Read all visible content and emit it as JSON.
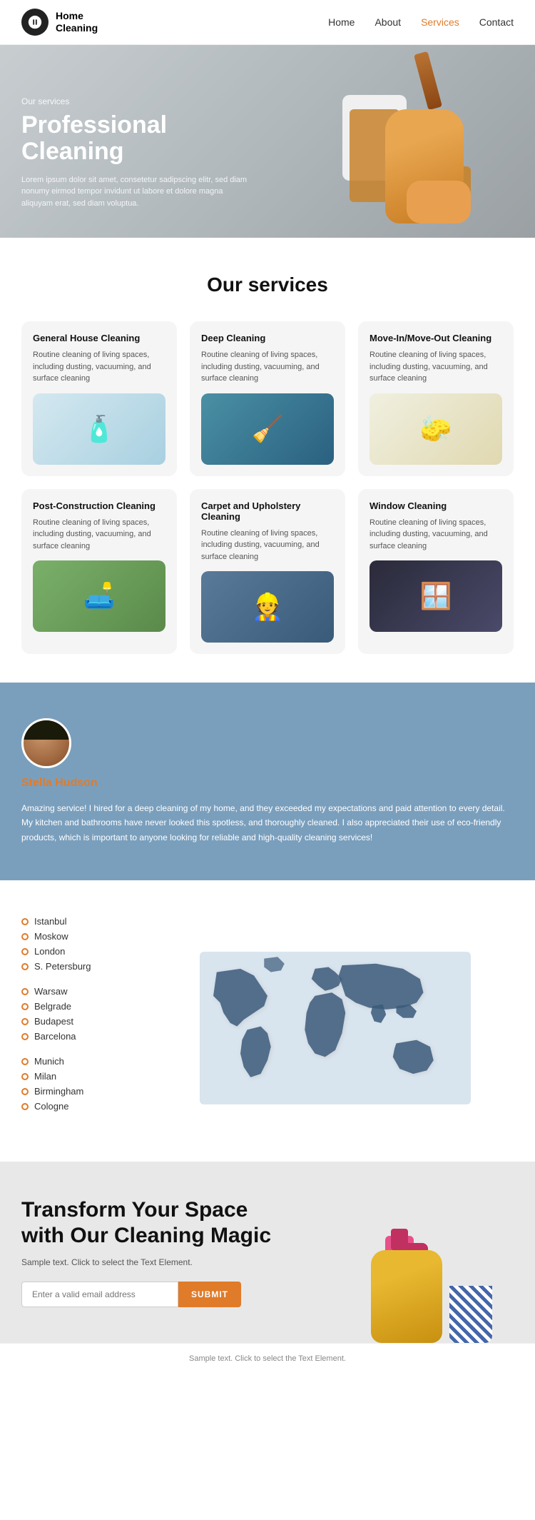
{
  "nav": {
    "logo_line1": "Home",
    "logo_line2": "Cleaning",
    "links": [
      {
        "label": "Home",
        "id": "home",
        "active": false
      },
      {
        "label": "About",
        "id": "about",
        "active": false
      },
      {
        "label": "Services",
        "id": "services",
        "active": true
      },
      {
        "label": "Contact",
        "id": "contact",
        "active": false
      }
    ]
  },
  "hero": {
    "label": "Our services",
    "title": "Professional Cleaning",
    "description": "Lorem ipsum dolor sit amet, consetetur sadipscing elitr, sed diam nonumy eirmod tempor invidunt ut labore et dolore magna aliquyam erat, sed diam voluptua."
  },
  "services": {
    "section_title": "Our services",
    "cards": [
      {
        "id": "general",
        "title": "General House Cleaning",
        "description": "Routine cleaning of living spaces, including dusting, vacuuming, and surface cleaning",
        "icon": "🧴"
      },
      {
        "id": "deep",
        "title": "Deep Cleaning",
        "description": "Routine cleaning of living spaces, including dusting, vacuuming, and surface cleaning",
        "icon": "🧹"
      },
      {
        "id": "movein",
        "title": "Move-In/Move-Out Cleaning",
        "description": "Routine cleaning of living spaces, including dusting, vacuuming, and surface cleaning",
        "icon": "🧽"
      },
      {
        "id": "postconstruction",
        "title": "Post-Construction Cleaning",
        "description": "Routine cleaning of living spaces, including dusting, vacuuming, and surface cleaning",
        "icon": "🛋️"
      },
      {
        "id": "carpet",
        "title": "Carpet and Upholstery Cleaning",
        "description": "Routine cleaning of living spaces, including dusting, vacuuming, and surface cleaning",
        "icon": "👷"
      },
      {
        "id": "window",
        "title": "Window Cleaning",
        "description": "Routine cleaning of living spaces, including dusting, vacuuming, and surface cleaning",
        "icon": "🪟"
      }
    ]
  },
  "testimonial": {
    "name": "Stella Hudson",
    "text": "Amazing service! I hired for a deep cleaning of my home, and they exceeded my expectations and paid attention to every detail. My kitchen and bathrooms have never looked this spotless, and thoroughly cleaned. I also appreciated their use of eco-friendly products, which is important to anyone looking for reliable and high-quality cleaning services!"
  },
  "locations": {
    "groups": [
      {
        "cities": [
          "Istanbul",
          "Moskow",
          "London",
          "S. Petersburg"
        ]
      },
      {
        "cities": [
          "Warsaw",
          "Belgrade",
          "Budapest",
          "Barcelona"
        ]
      },
      {
        "cities": [
          "Munich",
          "Milan",
          "Birmingham",
          "Cologne"
        ]
      }
    ]
  },
  "cta": {
    "title": "Transform Your Space with Our Cleaning Magic",
    "description": "Sample text. Click to select the Text Element.",
    "input_placeholder": "Enter a valid email address",
    "button_label": "SUBMIT"
  },
  "footer": {
    "text": "Sample text. Click to select the Text Element."
  }
}
